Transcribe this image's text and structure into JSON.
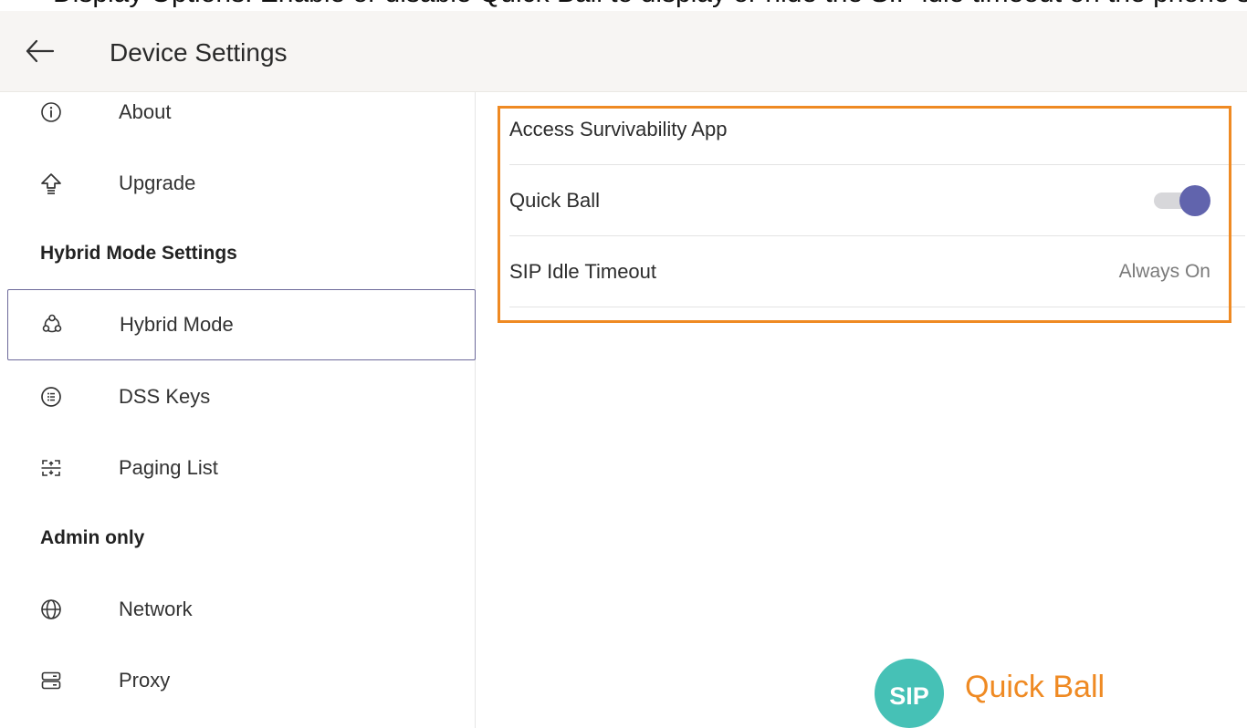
{
  "header": {
    "top_text": "Display Options: Enable or disable Quick Ball to display or hide the SIP idle timeout on the phone screen.",
    "title": "Device Settings",
    "back_icon": "arrow-left-icon"
  },
  "sidebar": {
    "items_top": [
      {
        "label": "About",
        "icon": "info-circle-icon"
      },
      {
        "label": "Upgrade",
        "icon": "upgrade-arrow-icon"
      }
    ],
    "section_hybrid": "Hybrid Mode Settings",
    "items_hybrid": [
      {
        "label": "Hybrid Mode",
        "icon": "hybrid-mode-icon",
        "selected": true
      },
      {
        "label": "DSS Keys",
        "icon": "dss-keys-icon"
      },
      {
        "label": "Paging List",
        "icon": "paging-list-icon"
      }
    ],
    "section_admin": "Admin only",
    "items_admin": [
      {
        "label": "Network",
        "icon": "globe-icon"
      },
      {
        "label": "Proxy",
        "icon": "server-icon"
      }
    ]
  },
  "content": {
    "rows": [
      {
        "label": "Access Survivability App"
      },
      {
        "label": "Quick Ball",
        "toggle_on": true
      },
      {
        "label": "SIP Idle Timeout",
        "value": "Always On"
      }
    ]
  },
  "overlay": {
    "ball_text": "SIP",
    "caption": "Quick Ball"
  },
  "colors": {
    "highlight": "#ef8a23",
    "toggle_thumb": "#6164ad",
    "sip_ball": "#46c1b6",
    "selected_border": "#6d6a9a"
  }
}
